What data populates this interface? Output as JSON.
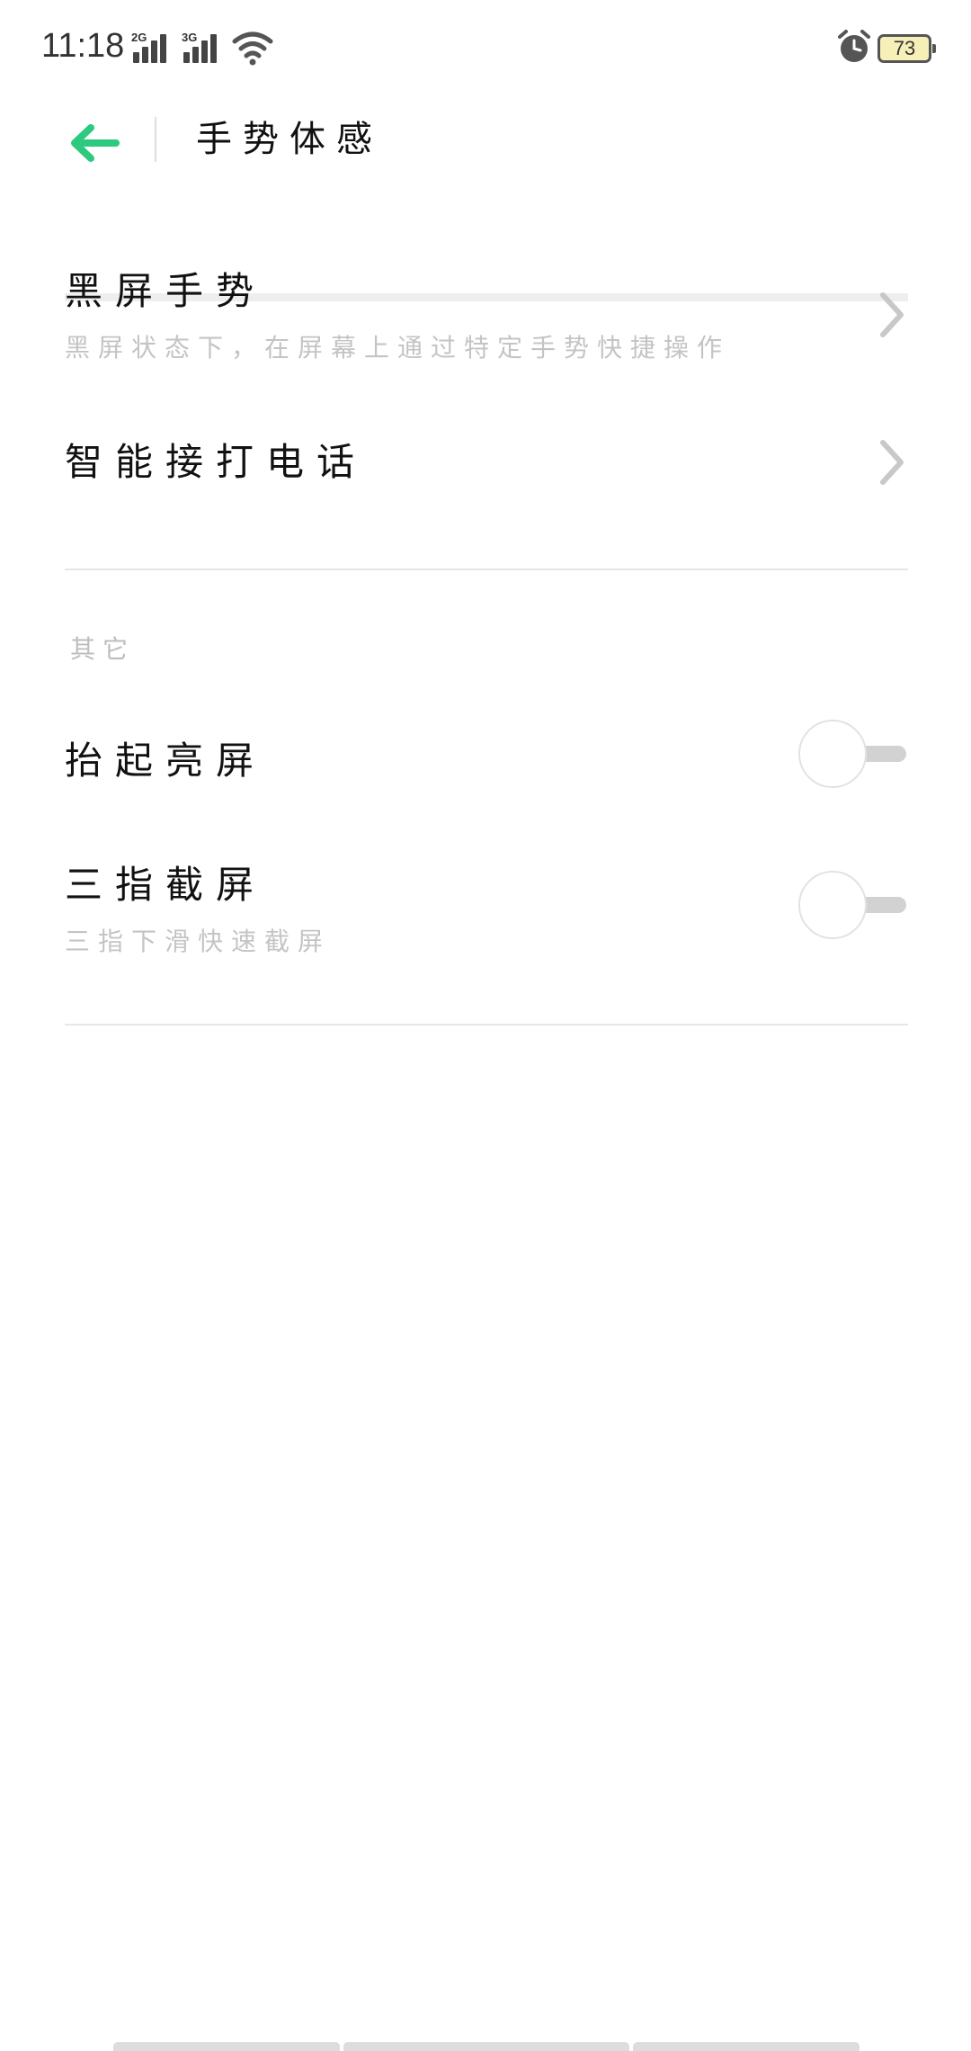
{
  "status_bar": {
    "time": "11:18",
    "signal_1_tag": "2G",
    "signal_2_tag": "3G",
    "battery_level": "73",
    "icons": [
      "signal-icon",
      "signal-icon",
      "wifi-icon",
      "alarm-icon",
      "battery-icon"
    ]
  },
  "header": {
    "back_icon": "arrow-left-icon",
    "title": "手势体感",
    "accent_color": "#2dc97e"
  },
  "items": [
    {
      "title": "黑屏手势",
      "subtitle": "黑屏状态下，在屏幕上通过特定手势快捷操作",
      "icon": "chevron-right-icon"
    },
    {
      "title": "智能接打电话",
      "icon": "chevron-right-icon"
    }
  ],
  "section_other": {
    "label": "其它",
    "toggles": [
      {
        "title": "抬起亮屏",
        "enabled": false
      },
      {
        "title": "三指截屏",
        "subtitle": "三指下滑快速截屏",
        "enabled": false
      }
    ]
  }
}
